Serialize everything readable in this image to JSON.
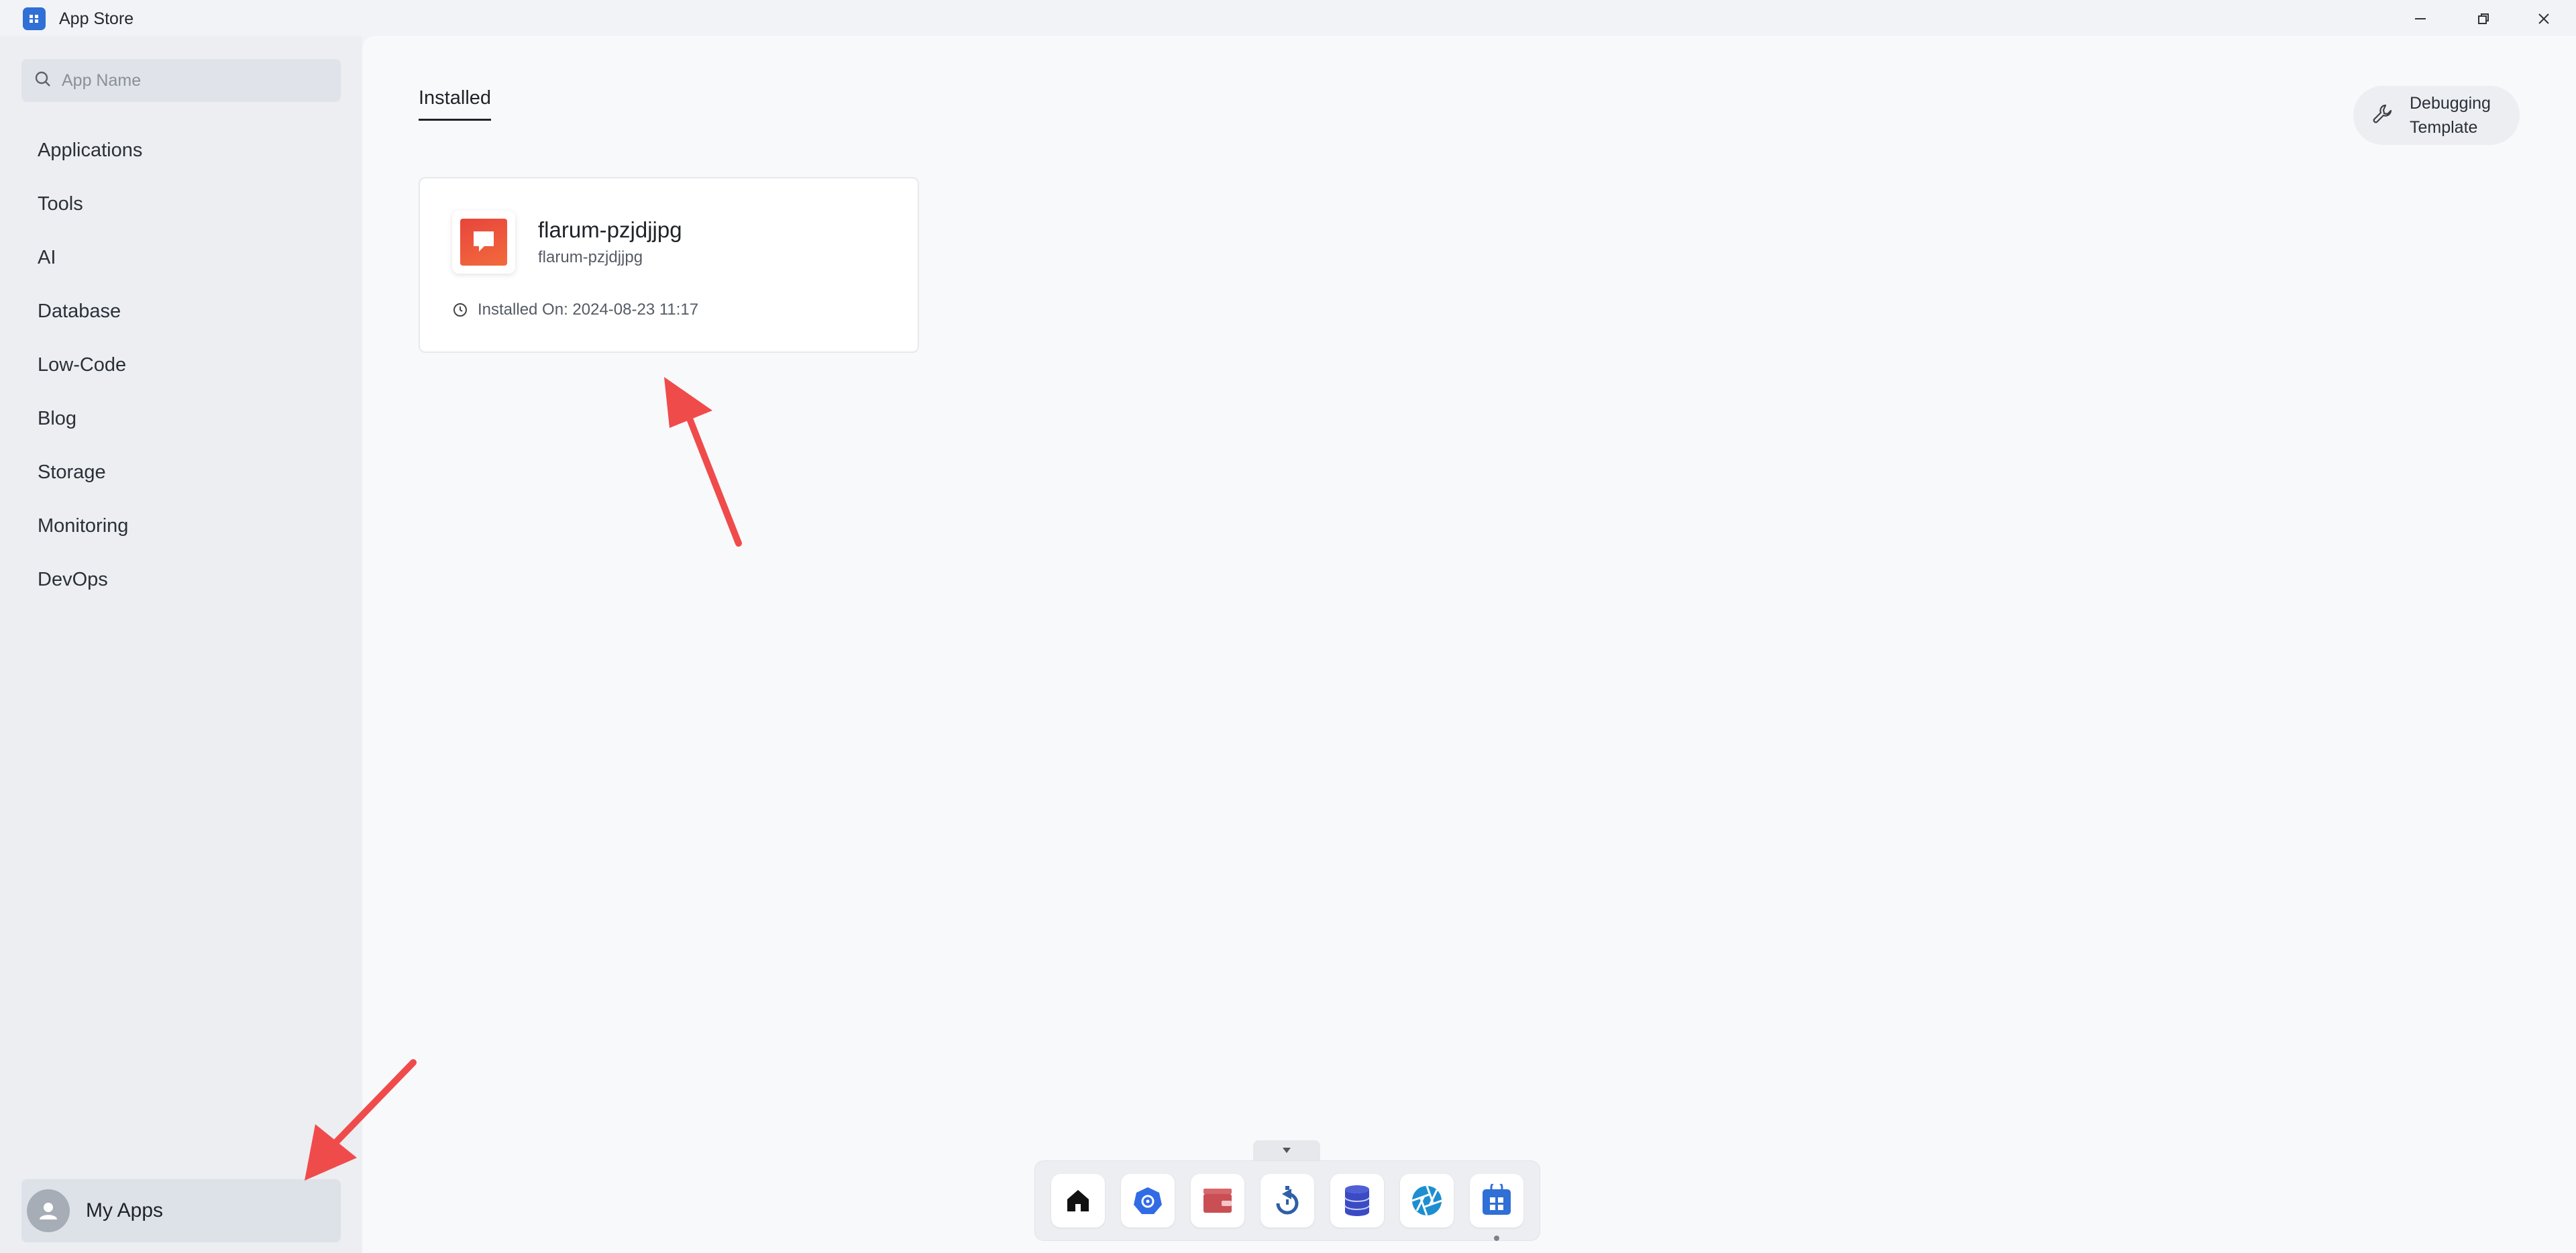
{
  "window": {
    "title": "App Store",
    "controls": [
      "minimize-icon",
      "restore-icon",
      "close-icon"
    ]
  },
  "sidebar": {
    "search": {
      "placeholder": "App Name",
      "value": ""
    },
    "items": [
      {
        "label": "Applications"
      },
      {
        "label": "Tools"
      },
      {
        "label": "AI"
      },
      {
        "label": "Database"
      },
      {
        "label": "Low-Code"
      },
      {
        "label": "Blog"
      },
      {
        "label": "Storage"
      },
      {
        "label": "Monitoring"
      },
      {
        "label": "DevOps"
      }
    ],
    "my_apps_label": "My Apps"
  },
  "main": {
    "tabs": [
      {
        "label": "Installed",
        "active": true
      }
    ],
    "debug_button_label": "Debugging\nTemplate",
    "cards": [
      {
        "title": "flarum-pzjdjjpg",
        "subtitle": "flarum-pzjdjjpg",
        "installed_on": "Installed On: 2024-08-23 11:17",
        "icon": "flarum-icon"
      }
    ]
  },
  "dock": {
    "items": [
      {
        "icon": "home-icon"
      },
      {
        "icon": "kubernetes-icon"
      },
      {
        "icon": "wallet-icon"
      },
      {
        "icon": "backup-icon"
      },
      {
        "icon": "database-icon"
      },
      {
        "icon": "aperture-icon"
      },
      {
        "icon": "app-store-icon",
        "active": true
      }
    ]
  },
  "colors": {
    "accent": "#2f6fd6",
    "arrow": "#f04b4b",
    "flarum": "#e8453c"
  }
}
